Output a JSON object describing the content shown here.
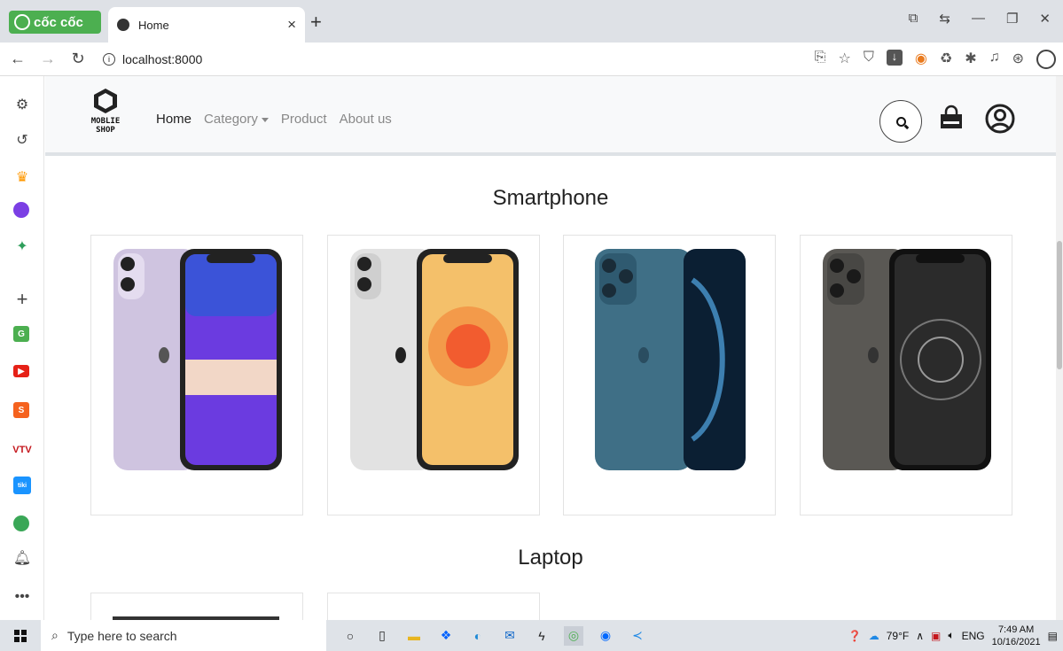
{
  "browser": {
    "brand": "cốc cốc",
    "tab_title": "Home",
    "tab_close": "×",
    "new_tab": "+",
    "url": "localhost:8000"
  },
  "site": {
    "logo_line1": "MOBLIE",
    "logo_line2": "SHOP",
    "nav": {
      "home": "Home",
      "category": "Category",
      "product": "Product",
      "about": "About us"
    }
  },
  "sections": {
    "smartphone_title": "Smartphone",
    "laptop_title": "Laptop"
  },
  "phones": [
    {
      "color": "#cfc4e0",
      "screen": "#7d4de0"
    },
    {
      "color": "#e6e6e6",
      "screen": "#f08a3c"
    },
    {
      "color": "#3f6f86",
      "screen": "#0e2a44"
    },
    {
      "color": "#5a5854",
      "screen": "#2b2b2b"
    }
  ],
  "taskbar": {
    "search_placeholder": "Type here to search",
    "weather": "79°F",
    "language": "ENG",
    "time": "7:49 AM",
    "date": "10/16/2021"
  }
}
